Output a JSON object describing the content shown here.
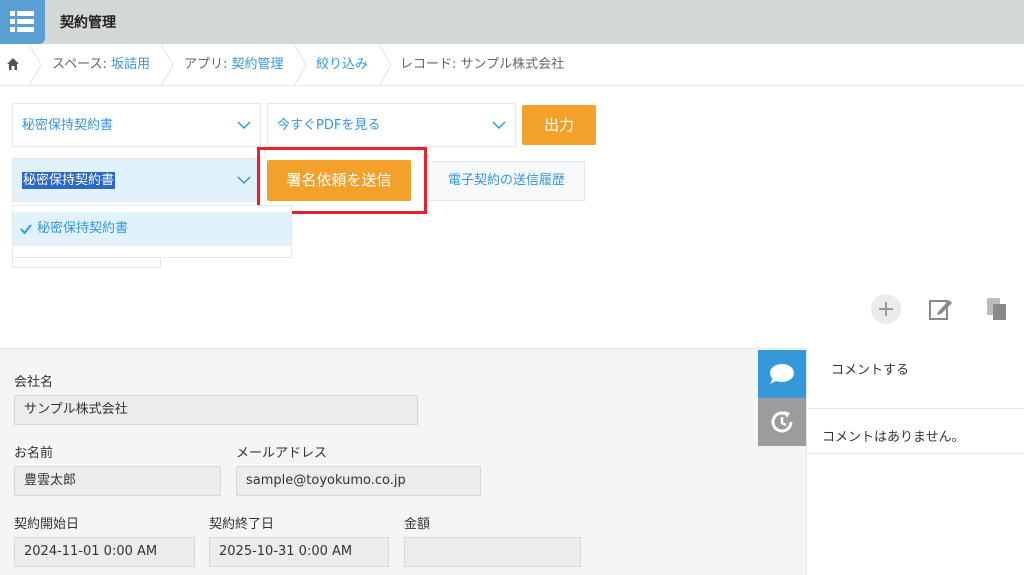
{
  "app": {
    "title": "契約管理"
  },
  "breadcrumb": {
    "space_prefix": "スペース: ",
    "space_name": "坂詰用",
    "app_prefix": "アプリ: ",
    "app_name": "契約管理",
    "filter": "絞り込み",
    "record": "レコード: サンプル株式会社"
  },
  "toolbar": {
    "template_select": "秘密保持契約書",
    "view_select": "今すぐPDFを見る",
    "output_button": "出力",
    "contract_select": "秘密保持契約書",
    "send_button": "署名依頼を送信",
    "history_button": "電子契約の送信履歴",
    "dropdown_options": [
      "秘密保持契約書"
    ]
  },
  "record": {
    "company_label": "会社名",
    "company_value": "サンプル株式会社",
    "name_label": "お名前",
    "name_value": "豊雲太郎",
    "email_label": "メールアドレス",
    "email_value": "sample@toyokumo.co.jp",
    "start_label": "契約開始日",
    "start_value": "2024-11-01 0:00 AM",
    "end_label": "契約終了日",
    "end_value": "2025-10-31 0:00 AM",
    "amount_label": "金額",
    "amount_value": ""
  },
  "comments": {
    "post_label": "コメントする",
    "empty_text": "コメントはありません。"
  },
  "colors": {
    "accent_blue": "#3498db",
    "orange": "#f4a12c",
    "highlight_red": "#e8222d"
  }
}
